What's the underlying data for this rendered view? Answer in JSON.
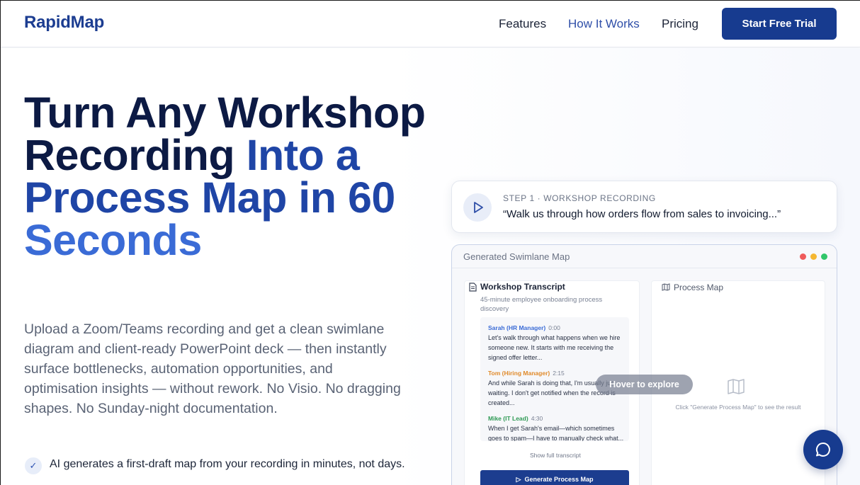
{
  "nav": {
    "logo": "RapidMap",
    "links": [
      "Features",
      "How It Works",
      "Pricing"
    ],
    "cta": "Start Free Trial"
  },
  "hero": {
    "headline_dark": "Turn Any Workshop Recording",
    "headline_blue1": "Into a Process Map in 60",
    "headline_blue2": "Seconds",
    "subtext": "Upload a Zoom/Teams recording and get a clean swimlane diagram and client-ready PowerPoint deck — then instantly surface bottlenecks, automation opportunities, and optimisation insights — without rework. No Visio. No dragging shapes. No Sunday-night documentation.",
    "bullets": [
      "AI generates a first-draft map from your recording in minutes, not days."
    ]
  },
  "step": {
    "label": "STEP 1 · WORKSHOP RECORDING",
    "quote": "“Walk us through how orders flow from sales to invoicing...”"
  },
  "map_window": {
    "title": "Generated Swimlane Map",
    "dot_colors": [
      "#ef5b5b",
      "#f5b731",
      "#31c66a"
    ],
    "transcript": {
      "title": "Workshop Transcript",
      "subtitle": "45-minute employee onboarding process discovery",
      "messages": [
        {
          "speaker": "Sarah (HR Manager)",
          "time": "0:00",
          "color": "#3a6bd6",
          "text": "Let's walk through what happens when we hire someone new. It starts with me receiving the signed offer letter..."
        },
        {
          "speaker": "Tom (Hiring Manager)",
          "time": "2:15",
          "color": "#e08a2a",
          "text": "And while Sarah is doing that, I'm usually just waiting. I don't get notified when the record is created..."
        },
        {
          "speaker": "Mike (IT Lead)",
          "time": "4:30",
          "color": "#2f9a55",
          "text": "When I get Sarah's email—which sometimes goes to spam—I have to manually check what..."
        }
      ],
      "show_full": "Show full transcript",
      "generate_btn": "Generate Process Map"
    },
    "process_map": {
      "title": "Process Map",
      "hint": "Click \"Generate Process Map\" to see the result"
    },
    "hover_pill": "Hover to explore"
  }
}
